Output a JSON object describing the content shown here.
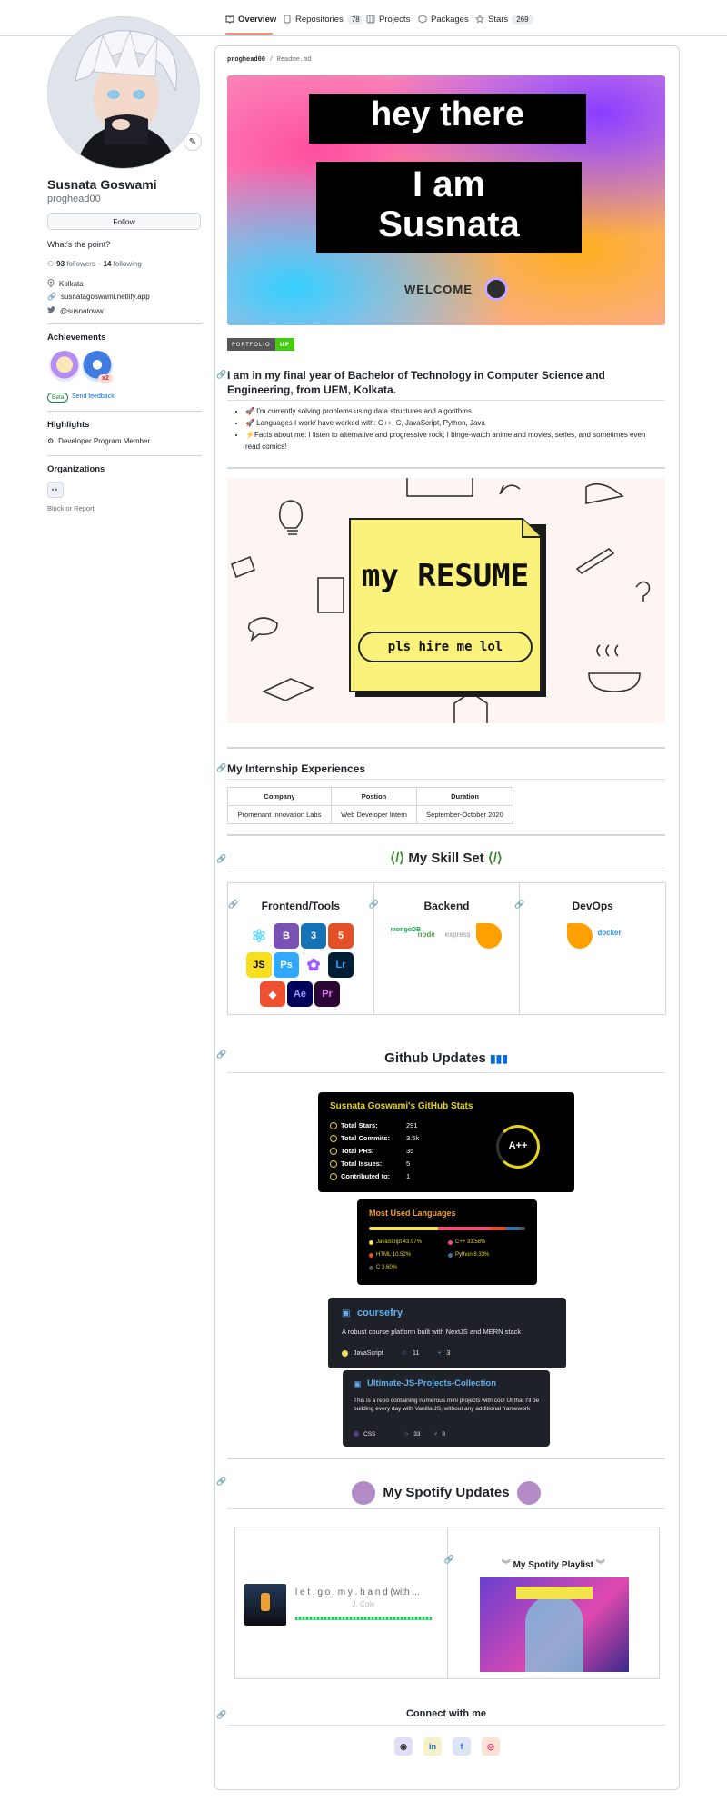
{
  "nav": {
    "tabs": [
      {
        "label": "Overview"
      },
      {
        "label": "Repositories",
        "count": "78"
      },
      {
        "label": "Projects"
      },
      {
        "label": "Packages"
      },
      {
        "label": "Stars",
        "count": "269"
      }
    ]
  },
  "profile": {
    "name": "Susnata Goswami",
    "login": "proghead00",
    "follow_label": "Follow",
    "bio": "What's the point?",
    "followers": "93",
    "followers_label": "followers",
    "following": "14",
    "following_label": "following",
    "location": "Kolkata",
    "website": "susnatagoswami.netlify.app",
    "twitter": "@susnatoww"
  },
  "achievements": {
    "title": "Achievements",
    "multiplier": "x2",
    "beta_label": "Beta",
    "feedback_label": "Send feedback"
  },
  "highlights": {
    "title": "Highlights",
    "item": "Developer Program Member"
  },
  "organizations": {
    "title": "Organizations",
    "block_label": "Block or Report"
  },
  "readme": {
    "path_user": "proghead00",
    "path_file": "Readme.md",
    "banner_line1": "hey there",
    "banner_line2": "I am",
    "banner_line3": "Susnata",
    "banner_welcome": "WELCOME",
    "badge_left": "PORTFOLIO",
    "badge_right": "UP",
    "intro_heading": "I am in my final year of Bachelor of Technology in Computer Science and Engineering, from UEM, Kolkata.",
    "bullets": [
      "🚀 I'm currently solving problems using data structures and algorithms",
      "🚀 Languages I work/ have worked with: C++, C, JavaScript, Python, Java",
      "⚡Facts about me: I listen to alternative and progressive rock; I binge-watch anime and movies, series, and sometimes even read comics!"
    ],
    "resume_title": "my RESUME",
    "resume_sub": "pls hire me lol",
    "intern_heading": "My Internship Experiences",
    "intern_headers": [
      "Company",
      "Postion",
      "Duration"
    ],
    "intern_row": [
      "Promenant Innovation Labs",
      "Web Developer Intern",
      "September-October 2020"
    ],
    "skill_heading": "My Skill Set",
    "skill_cols": [
      "Frontend/Tools",
      "Backend",
      "DevOps"
    ],
    "backend_logos": [
      "mongoDB",
      "node",
      "express"
    ],
    "devops_logos": [
      "docker"
    ],
    "github_heading": "Github Updates",
    "stats": {
      "title": "Susnata Goswami's GitHub Stats",
      "rows": [
        {
          "k": "Total Stars:",
          "v": "291"
        },
        {
          "k": "Total Commits:",
          "v": "3.5k"
        },
        {
          "k": "Total PRs:",
          "v": "35"
        },
        {
          "k": "Total Issues:",
          "v": "5"
        },
        {
          "k": "Contributed to:",
          "v": "1"
        }
      ],
      "grade": "A++"
    },
    "langs": {
      "title": "Most Used Languages",
      "items": [
        {
          "name": "JavaScript 43.97%",
          "color": "#f1e05a",
          "pct": 43.97
        },
        {
          "name": "C++ 33.58%",
          "color": "#f34b7d",
          "pct": 33.58
        },
        {
          "name": "HTML 10.52%",
          "color": "#e34c26",
          "pct": 10.52
        },
        {
          "name": "Python 8.33%",
          "color": "#3572a5",
          "pct": 8.33
        },
        {
          "name": "C 3.60%",
          "color": "#555555",
          "pct": 3.6
        }
      ]
    },
    "repo1": {
      "name": "coursefry",
      "desc": "A robust course platform built with NextJS and MERN stack",
      "lang": "JavaScript",
      "stars": "11",
      "forks": "3"
    },
    "repo2": {
      "name": "Ultimate-JS-Projects-Collection",
      "desc": "This is a repo containing numerous mini projects with cool UI that I'll be building every day with Vanilla JS, without any additional framework",
      "lang": "CSS",
      "stars": "33",
      "forks": "8"
    },
    "spotify_heading": "My Spotify Updates",
    "now_playing_title": "l e t . g o . m y . h a n d (with ...",
    "now_playing_artist": "J. Cole",
    "playlist_title": "My Spotify Playlist",
    "connect_heading": "Connect with me"
  }
}
